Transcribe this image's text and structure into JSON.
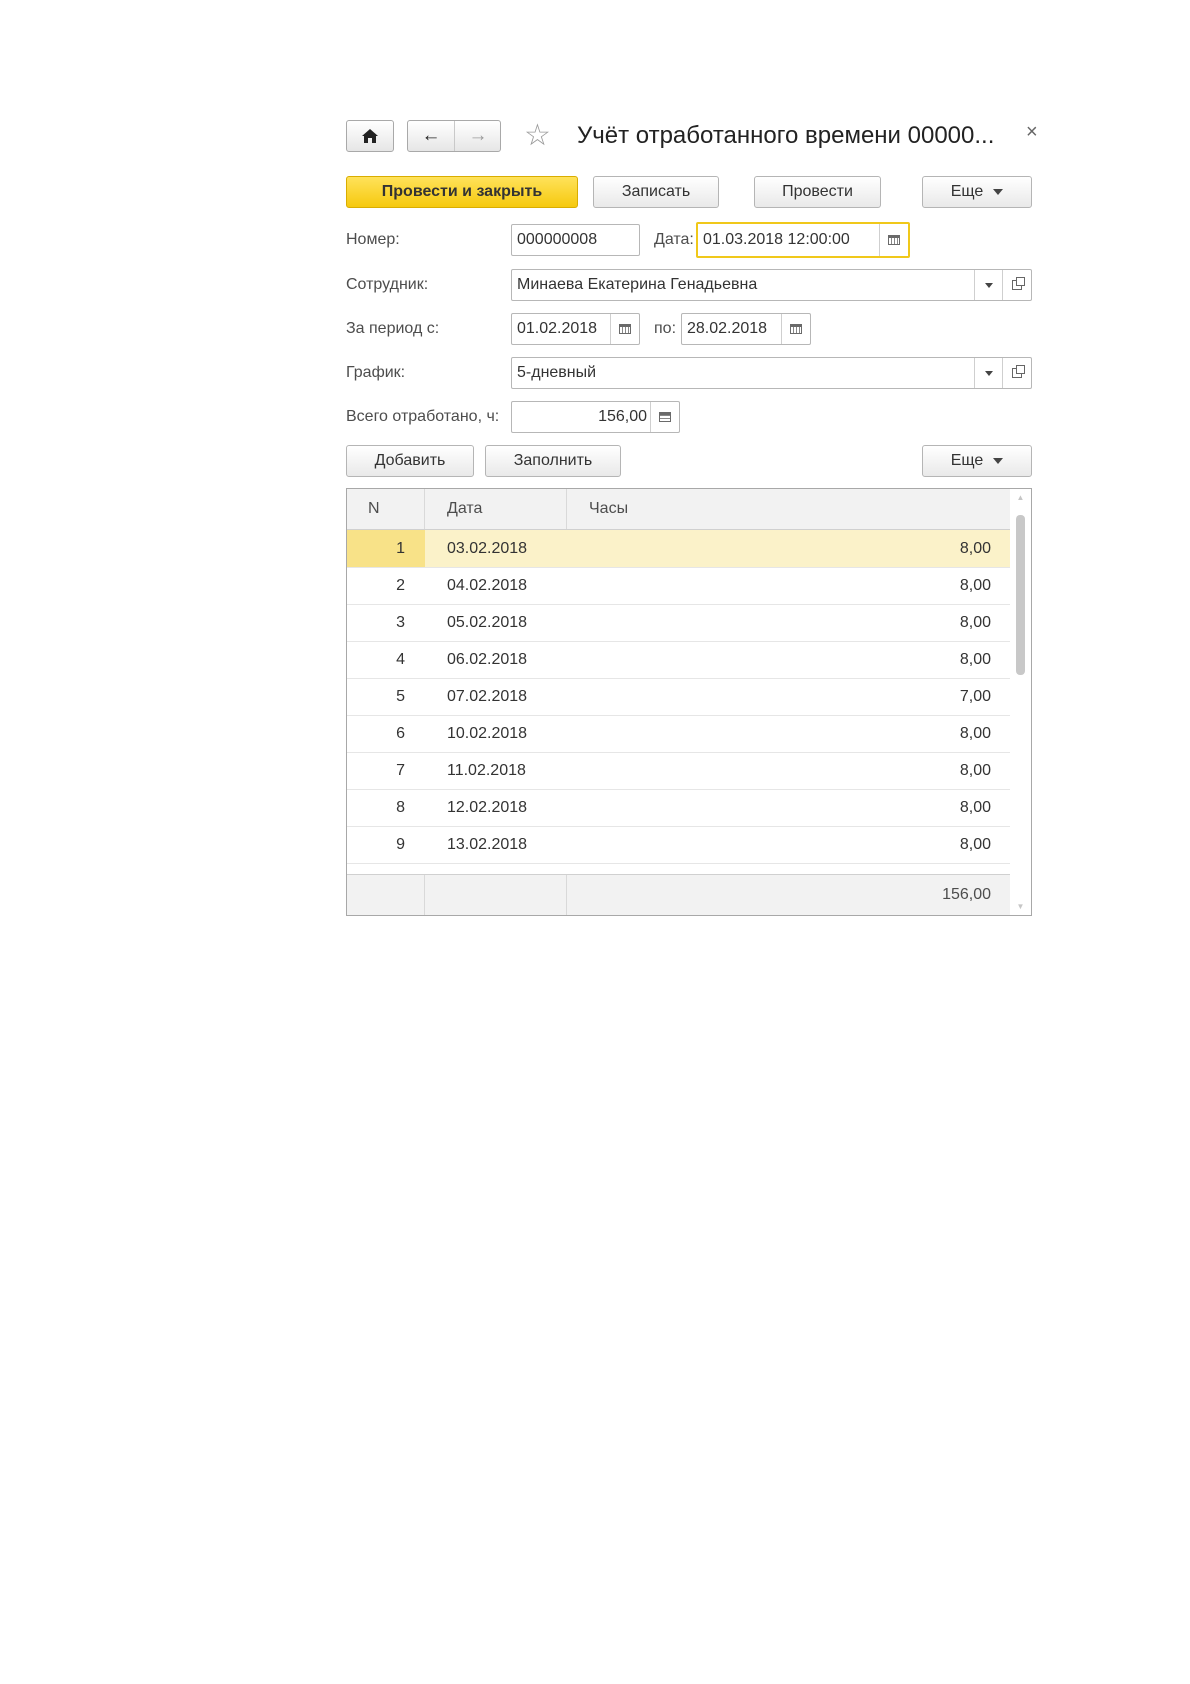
{
  "window": {
    "title": "Учёт отработанного времени 00000...",
    "close_glyph": "×",
    "star_glyph": "☆",
    "home_glyph": "⌂",
    "back_glyph": "←",
    "forward_glyph": "→"
  },
  "toolbar": {
    "post_close": "Провести и закрыть",
    "save": "Записать",
    "post": "Провести",
    "more": "Еще"
  },
  "form": {
    "number_label": "Номер:",
    "number_value": "000000008",
    "date_label": "Дата:",
    "date_value": "01.03.2018 12:00:00",
    "employee_label": "Сотрудник:",
    "employee_value": "Минаева Екатерина Генадьевна",
    "period_label": "За период с:",
    "period_from": "01.02.2018",
    "period_to_label": "по:",
    "period_to": "28.02.2018",
    "schedule_label": "График:",
    "schedule_value": "5-дневный",
    "total_label": "Всего отработано, ч:",
    "total_value": "156,00"
  },
  "table_toolbar": {
    "add": "Добавить",
    "fill": "Заполнить",
    "more": "Еще"
  },
  "table": {
    "columns": [
      "N",
      "Дата",
      "Часы"
    ],
    "rows": [
      {
        "n": "1",
        "date": "03.02.2018",
        "hours": "8,00"
      },
      {
        "n": "2",
        "date": "04.02.2018",
        "hours": "8,00"
      },
      {
        "n": "3",
        "date": "05.02.2018",
        "hours": "8,00"
      },
      {
        "n": "4",
        "date": "06.02.2018",
        "hours": "8,00"
      },
      {
        "n": "5",
        "date": "07.02.2018",
        "hours": "7,00"
      },
      {
        "n": "6",
        "date": "10.02.2018",
        "hours": "8,00"
      },
      {
        "n": "7",
        "date": "11.02.2018",
        "hours": "8,00"
      },
      {
        "n": "8",
        "date": "12.02.2018",
        "hours": "8,00"
      },
      {
        "n": "9",
        "date": "13.02.2018",
        "hours": "8,00"
      }
    ],
    "selected_row": 0,
    "footer_total": "156,00"
  },
  "colors": {
    "accent_yellow": "#f6c90e",
    "selected_row": "#fbf2c9",
    "focus_border": "#f0c81a"
  }
}
